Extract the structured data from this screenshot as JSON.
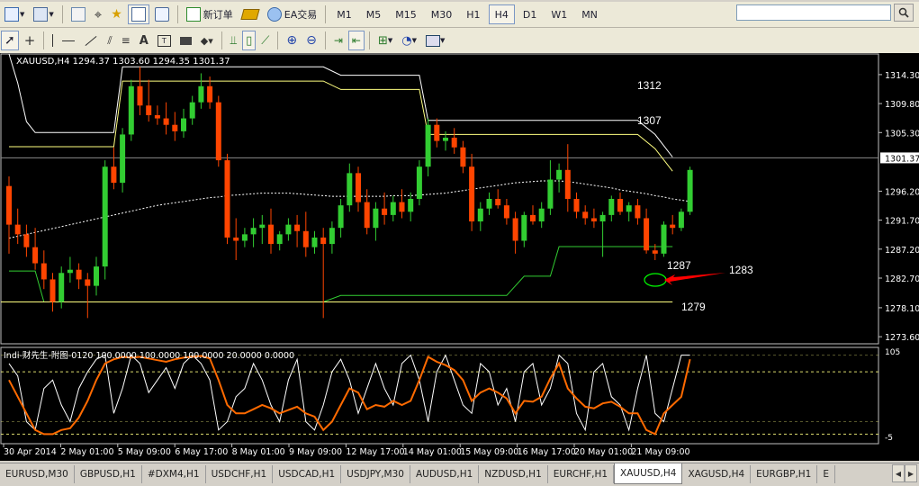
{
  "toolbar": {
    "new_order_label": "新订单",
    "ea_label": "EA交易",
    "timeframes": [
      "M1",
      "M5",
      "M15",
      "M30",
      "H1",
      "H4",
      "D1",
      "W1",
      "MN"
    ],
    "active_timeframe": "H4"
  },
  "search": {
    "value": ""
  },
  "chart": {
    "info_label": "XAUUSD,H4  1294.37 1303.60 1294.35 1301.37",
    "symbol": "XAUUSD",
    "timeframe": "H4",
    "ohlc": {
      "open": 1294.37,
      "high": 1303.6,
      "low": 1294.35,
      "close": 1301.37
    },
    "current_price_label": "1301.37",
    "price_ticks": [
      "1314.30",
      "1309.80",
      "1305.30",
      "1296.20",
      "1291.70",
      "1287.20",
      "1282.70",
      "1278.10",
      "1273.60"
    ],
    "price_range": [
      1272.5,
      1317.5
    ],
    "time_labels": [
      "30 Apr 2014",
      "2 May 01:00",
      "5 May 09:00",
      "6 May 17:00",
      "8 May 01:00",
      "9 May 09:00",
      "12 May 17:00",
      "14 May 01:00",
      "15 May 09:00",
      "16 May 17:00",
      "20 May 01:00",
      "21 May 09:00"
    ],
    "annotations": [
      "1312",
      "1307",
      "1287",
      "1283",
      "1279"
    ],
    "indicator_label": "Indi-财先生-附图-0120 100.0000 100.0000 100.0000 20.0000 0.0000",
    "indicator_ticks": [
      "105",
      "100",
      "0",
      "-5"
    ],
    "colors": {
      "background": "#000000",
      "bull_candle": "#32cd32",
      "bear_candle": "#ff4500",
      "upper_channel": "#ffff80",
      "lower_channel": "#32cd32",
      "moving_average": "#ffffff",
      "arrow": "#ff0000",
      "ellipse": "#00ff00",
      "indicator_main": "#ff6a00",
      "indicator_signal": "#ffffff",
      "indicator_levels": "#ffff80"
    },
    "candles": [
      [
        1297.0,
        1298.5,
        1286.5,
        1291.0
      ],
      [
        1291.0,
        1293.5,
        1288.0,
        1289.5
      ],
      [
        1289.5,
        1291.0,
        1286.0,
        1287.5
      ],
      [
        1287.5,
        1290.5,
        1284.0,
        1285.0
      ],
      [
        1285.0,
        1287.0,
        1281.0,
        1282.5
      ],
      [
        1282.5,
        1283.5,
        1277.5,
        1279.0
      ],
      [
        1279.0,
        1284.5,
        1278.0,
        1283.5
      ],
      [
        1283.5,
        1286.0,
        1282.0,
        1284.0
      ],
      [
        1284.0,
        1285.0,
        1281.0,
        1282.5
      ],
      [
        1282.5,
        1283.5,
        1276.5,
        1281.5
      ],
      [
        1281.5,
        1286.0,
        1280.0,
        1284.5
      ],
      [
        1284.5,
        1301.0,
        1282.5,
        1300.0
      ],
      [
        1300.0,
        1303.0,
        1296.5,
        1297.5
      ],
      [
        1297.5,
        1306.0,
        1296.0,
        1305.0
      ],
      [
        1305.0,
        1313.5,
        1304.0,
        1312.5
      ],
      [
        1312.5,
        1315.5,
        1308.0,
        1309.5
      ],
      [
        1309.5,
        1313.5,
        1307.0,
        1308.0
      ],
      [
        1308.0,
        1309.5,
        1306.5,
        1307.5
      ],
      [
        1307.5,
        1310.0,
        1305.0,
        1306.5
      ],
      [
        1306.5,
        1308.5,
        1304.0,
        1305.5
      ],
      [
        1305.5,
        1309.0,
        1304.5,
        1307.5
      ],
      [
        1307.5,
        1311.0,
        1306.5,
        1310.0
      ],
      [
        1310.0,
        1314.5,
        1309.0,
        1312.5
      ],
      [
        1312.5,
        1314.0,
        1309.0,
        1310.0
      ],
      [
        1310.0,
        1311.0,
        1300.0,
        1301.0
      ],
      [
        1301.0,
        1302.0,
        1288.0,
        1289.0
      ],
      [
        1289.0,
        1292.0,
        1285.5,
        1288.5
      ],
      [
        1288.5,
        1290.5,
        1287.5,
        1289.5
      ],
      [
        1289.5,
        1292.0,
        1287.5,
        1290.5
      ],
      [
        1290.5,
        1292.5,
        1288.0,
        1291.0
      ],
      [
        1291.0,
        1293.5,
        1286.5,
        1288.0
      ],
      [
        1288.0,
        1290.0,
        1287.0,
        1289.5
      ],
      [
        1289.5,
        1292.0,
        1288.5,
        1291.0
      ],
      [
        1291.0,
        1292.5,
        1287.5,
        1290.0
      ],
      [
        1290.0,
        1293.0,
        1286.0,
        1287.5
      ],
      [
        1287.5,
        1290.0,
        1286.5,
        1289.0
      ],
      [
        1289.0,
        1290.5,
        1276.5,
        1288.0
      ],
      [
        1288.0,
        1291.5,
        1286.5,
        1290.5
      ],
      [
        1290.5,
        1295.0,
        1289.0,
        1294.0
      ],
      [
        1294.0,
        1300.5,
        1293.0,
        1299.0
      ],
      [
        1299.0,
        1300.0,
        1293.0,
        1294.5
      ],
      [
        1294.5,
        1296.5,
        1289.5,
        1290.5
      ],
      [
        1290.5,
        1294.5,
        1288.5,
        1293.5
      ],
      [
        1293.5,
        1296.0,
        1291.0,
        1292.5
      ],
      [
        1292.5,
        1295.5,
        1291.5,
        1294.5
      ],
      [
        1294.5,
        1296.5,
        1292.0,
        1293.0
      ],
      [
        1293.0,
        1296.0,
        1291.5,
        1295.0
      ],
      [
        1295.0,
        1301.0,
        1294.0,
        1300.0
      ],
      [
        1300.0,
        1307.5,
        1298.5,
        1306.5
      ],
      [
        1306.5,
        1307.5,
        1303.0,
        1304.0
      ],
      [
        1304.0,
        1305.5,
        1302.5,
        1304.5
      ],
      [
        1304.5,
        1306.0,
        1302.0,
        1303.0
      ],
      [
        1303.0,
        1304.0,
        1299.0,
        1300.0
      ],
      [
        1300.0,
        1302.0,
        1290.0,
        1291.5
      ],
      [
        1291.5,
        1294.5,
        1290.0,
        1293.5
      ],
      [
        1293.5,
        1296.0,
        1292.5,
        1295.0
      ],
      [
        1295.0,
        1296.5,
        1293.5,
        1294.0
      ],
      [
        1294.0,
        1295.0,
        1291.0,
        1292.0
      ],
      [
        1292.0,
        1293.0,
        1286.5,
        1288.5
      ],
      [
        1288.5,
        1293.0,
        1287.5,
        1292.5
      ],
      [
        1292.5,
        1294.0,
        1291.0,
        1291.5
      ],
      [
        1291.5,
        1294.5,
        1290.5,
        1293.5
      ],
      [
        1293.5,
        1301.0,
        1292.5,
        1298.0
      ],
      [
        1298.0,
        1300.5,
        1296.0,
        1299.5
      ],
      [
        1299.5,
        1303.5,
        1293.0,
        1295.0
      ],
      [
        1295.0,
        1296.0,
        1292.0,
        1293.0
      ],
      [
        1293.0,
        1294.0,
        1291.0,
        1292.0
      ],
      [
        1292.0,
        1293.5,
        1290.5,
        1291.5
      ],
      [
        1291.5,
        1293.0,
        1286.0,
        1292.5
      ],
      [
        1292.5,
        1295.5,
        1291.5,
        1295.0
      ],
      [
        1295.0,
        1296.0,
        1292.5,
        1293.0
      ],
      [
        1293.0,
        1294.5,
        1291.5,
        1294.0
      ],
      [
        1294.0,
        1295.0,
        1291.0,
        1292.0
      ],
      [
        1292.0,
        1293.5,
        1286.5,
        1287.0
      ],
      [
        1287.0,
        1288.0,
        1285.5,
        1286.5
      ],
      [
        1286.5,
        1291.5,
        1286.0,
        1291.0
      ],
      [
        1291.0,
        1292.5,
        1289.5,
        1290.5
      ],
      [
        1290.5,
        1293.5,
        1290.0,
        1293.0
      ],
      [
        1293.0,
        1300.0,
        1292.5,
        1299.5
      ]
    ],
    "ma": [
      1288.9,
      1289.2,
      1289.5,
      1289.8,
      1290.1,
      1290.4,
      1290.7,
      1291.0,
      1291.3,
      1291.6,
      1291.9,
      1292.2,
      1292.5,
      1292.8,
      1293.1,
      1293.4,
      1293.7,
      1294.0,
      1294.2,
      1294.4,
      1294.6,
      1294.8,
      1295.0,
      1295.2,
      1295.3,
      1295.5,
      1295.6,
      1295.7,
      1295.8,
      1295.9,
      1295.9,
      1295.9,
      1295.9,
      1295.8,
      1295.7,
      1295.6,
      1295.5,
      1295.4,
      1295.4,
      1295.4,
      1295.4,
      1295.4,
      1295.4,
      1295.4,
      1295.5,
      1295.5,
      1295.5,
      1295.6,
      1295.7,
      1295.8,
      1295.9,
      1296.1,
      1296.3,
      1296.5,
      1296.7,
      1296.9,
      1297.1,
      1297.3,
      1297.5,
      1297.6,
      1297.7,
      1297.8,
      1297.8,
      1297.8,
      1297.7,
      1297.5,
      1297.3,
      1297.1,
      1296.9,
      1296.7,
      1296.4,
      1296.2,
      1296.0,
      1295.8,
      1295.5,
      1295.3,
      1295.0,
      1294.8,
      1294.6
    ],
    "osc_main": [
      70,
      50,
      30,
      10,
      5,
      5,
      10,
      12,
      25,
      45,
      70,
      90,
      95,
      98,
      97,
      98,
      96,
      94,
      92,
      95,
      97,
      98,
      99,
      96,
      70,
      40,
      30,
      30,
      35,
      40,
      36,
      30,
      34,
      38,
      30,
      26,
      10,
      20,
      40,
      60,
      55,
      35,
      40,
      38,
      45,
      40,
      45,
      70,
      98,
      92,
      88,
      82,
      70,
      45,
      55,
      60,
      55,
      48,
      30,
      45,
      44,
      50,
      72,
      90,
      60,
      48,
      38,
      36,
      42,
      44,
      38,
      30,
      30,
      10,
      5,
      30,
      40,
      50,
      95
    ],
    "osc_signal": [
      90,
      75,
      20,
      10,
      60,
      70,
      40,
      20,
      60,
      80,
      95,
      100,
      30,
      60,
      100,
      90,
      55,
      70,
      85,
      60,
      90,
      100,
      90,
      70,
      10,
      20,
      50,
      60,
      90,
      70,
      40,
      20,
      70,
      95,
      20,
      10,
      40,
      80,
      95,
      70,
      30,
      60,
      90,
      60,
      40,
      90,
      100,
      70,
      20,
      80,
      100,
      70,
      40,
      30,
      90,
      80,
      40,
      60,
      20,
      80,
      90,
      40,
      60,
      100,
      90,
      30,
      10,
      80,
      90,
      50,
      40,
      10,
      60,
      100,
      30,
      20,
      60,
      100,
      100
    ]
  },
  "symbol_tabs": [
    "EURUSD,M30",
    "GBPUSD,H1",
    "#DXM4,H1",
    "USDCHF,H1",
    "USDCAD,H1",
    "USDJPY,M30",
    "AUDUSD,H1",
    "NZDUSD,H1",
    "EURCHF,H1",
    "XAUUSD,H4",
    "XAGUSD,H4",
    "EURGBP,H1",
    "E"
  ],
  "active_tab": "XAUUSD,H4"
}
